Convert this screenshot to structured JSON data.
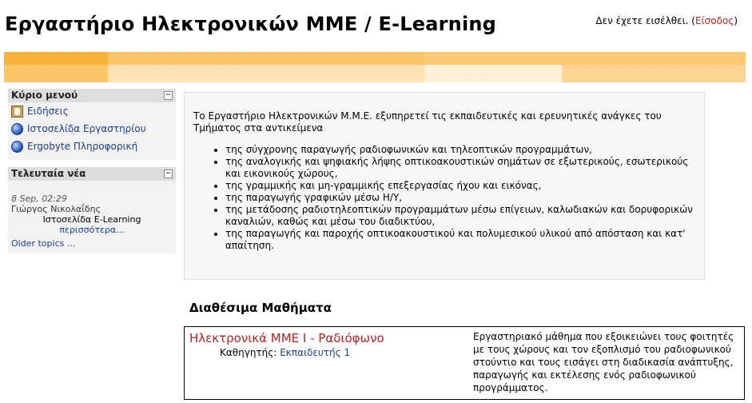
{
  "header": {
    "site_title": "Εργαστήριο Ηλεκτρονικών ΜΜΕ / E-Learning",
    "login_prefix": "Δεν έχετε εισέλθει. (",
    "login_link": "Είσοδος",
    "login_suffix": ")"
  },
  "colors": {
    "accent_orange": "#fbb13a",
    "accent_light": "#fdd89a",
    "link": "#1a3d8f",
    "course_title": "#b22222"
  },
  "main_menu": {
    "title": "Κύριο μενού",
    "items": [
      {
        "label": "Ειδήσεις",
        "icon": "news-icon"
      },
      {
        "label": "Ιστοσελίδα Εργαστηρίου",
        "icon": "globe-icon"
      },
      {
        "label": "Ergobyte Πληροφορική",
        "icon": "globe-icon"
      }
    ]
  },
  "latest_news": {
    "title": "Τελευταία νέα",
    "date": "8 Sep, 02:29",
    "author": "Γιώργος Νικολαΐδης",
    "headline": "Ιστοσελίδα E-Learning",
    "more": "περισσότερα...",
    "older": "Older topics ..."
  },
  "intro": {
    "paragraph": "Το Εργαστήριο Ηλεκτρονικών Μ.Μ.Ε. εξυπηρετεί τις εκπαιδευτικές και ερευνητικές ανάγκες του Τμήματος στα αντικείμενα",
    "bullets": [
      "της σύγχρονης παραγωγής ραδιοφωνικών και τηλεοπτικών προγραμμάτων,",
      "της αναλογικής και ψηφιακής λήψης οπτικοακουστικών σημάτων σε εξωτερικούς, εσωτερικούς και εικονικούς χώρους,",
      "της γραμμικής και μη-γραμμικής επεξεργασίας ήχου και εικόνας,",
      "της παραγωγής γραφικών μέσω Η/Υ,",
      "της μετάδοσης ραδιοτηλεοπτικών προγραμμάτων μέσω επίγειων, καλωδιακών και δορυφορικών καναλιών, καθώς και μέσω του διαδικτύου,",
      "της παραγωγής και παροχής οπτικοακουστικού και πολυμεσικού υλικού από απόσταση και κατ' απαίτηση."
    ]
  },
  "courses": {
    "heading": "Διαθέσιμα Μαθήματα",
    "items": [
      {
        "name": "Ηλεκτρονικά ΜΜΕ Ι - Ραδιόφωνο",
        "teacher_label": "Καθηγητής:",
        "teacher_name": "Εκπαιδευτής 1",
        "summary": "Εργαστηριακό μάθημα που εξοικειώνει τους φοιτητές με τους χώρους και τον εξοπλισμό του ραδιοφωνικού στούντιο και τους εισάγει στη διαδικασία ανάπτυξης, παραγωγής και εκτέλεσης ενός ραδιοφωνικού προγράμματος."
      }
    ]
  }
}
